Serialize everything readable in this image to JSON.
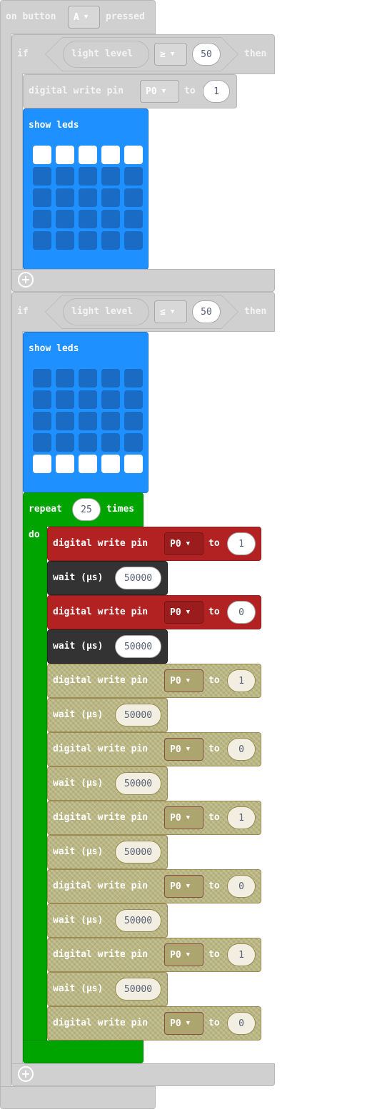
{
  "event": {
    "prefix": "on button",
    "button": "A",
    "suffix": "pressed"
  },
  "if1": {
    "if_label": "if",
    "sensor": "light level",
    "operator": "≥",
    "value": "50",
    "then_label": "then",
    "digital_write": {
      "label": "digital write pin",
      "pin": "P0",
      "to": "to",
      "value": "1"
    },
    "show_leds": {
      "label": "show leds",
      "grid": [
        [
          1,
          1,
          1,
          1,
          1
        ],
        [
          0,
          0,
          0,
          0,
          0
        ],
        [
          0,
          0,
          0,
          0,
          0
        ],
        [
          0,
          0,
          0,
          0,
          0
        ],
        [
          0,
          0,
          0,
          0,
          0
        ]
      ]
    }
  },
  "if2": {
    "if_label": "if",
    "sensor": "light level",
    "operator": "≤",
    "value": "50",
    "then_label": "then",
    "show_leds": {
      "label": "show leds",
      "grid": [
        [
          0,
          0,
          0,
          0,
          0
        ],
        [
          0,
          0,
          0,
          0,
          0
        ],
        [
          0,
          0,
          0,
          0,
          0
        ],
        [
          0,
          0,
          0,
          0,
          0
        ],
        [
          1,
          1,
          1,
          1,
          1
        ]
      ]
    },
    "repeat": {
      "label": "repeat",
      "times_value": "25",
      "times_label": "times",
      "do_label": "do",
      "body": [
        {
          "kind": "write",
          "style": "active",
          "label": "digital write pin",
          "pin": "P0",
          "to": "to",
          "value": "1"
        },
        {
          "kind": "wait",
          "style": "active",
          "label": "wait (µs)",
          "value": "50000"
        },
        {
          "kind": "write",
          "style": "active",
          "label": "digital write pin",
          "pin": "P0",
          "to": "to",
          "value": "0"
        },
        {
          "kind": "wait",
          "style": "active",
          "label": "wait (µs)",
          "value": "50000"
        },
        {
          "kind": "write",
          "style": "disabled",
          "label": "digital write pin",
          "pin": "P0",
          "to": "to",
          "value": "1"
        },
        {
          "kind": "wait",
          "style": "disabled",
          "label": "wait (µs)",
          "value": "50000"
        },
        {
          "kind": "write",
          "style": "disabled",
          "label": "digital write pin",
          "pin": "P0",
          "to": "to",
          "value": "0"
        },
        {
          "kind": "wait",
          "style": "disabled",
          "label": "wait (µs)",
          "value": "50000"
        },
        {
          "kind": "write",
          "style": "disabled",
          "label": "digital write pin",
          "pin": "P0",
          "to": "to",
          "value": "1"
        },
        {
          "kind": "wait",
          "style": "disabled",
          "label": "wait (µs)",
          "value": "50000"
        },
        {
          "kind": "write",
          "style": "disabled",
          "label": "digital write pin",
          "pin": "P0",
          "to": "to",
          "value": "0"
        },
        {
          "kind": "wait",
          "style": "disabled",
          "label": "wait (µs)",
          "value": "50000"
        },
        {
          "kind": "write",
          "style": "disabled",
          "label": "digital write pin",
          "pin": "P0",
          "to": "to",
          "value": "1"
        },
        {
          "kind": "wait",
          "style": "disabled",
          "label": "wait (µs)",
          "value": "50000"
        },
        {
          "kind": "write",
          "style": "disabled",
          "label": "digital write pin",
          "pin": "P0",
          "to": "to",
          "value": "0"
        }
      ]
    }
  },
  "colors": {
    "logic": "#d0d0d0",
    "basic": "#1e90ff",
    "loops": "#00a400",
    "pins": "#b22222",
    "control": "#333333",
    "disabled": "#b9b77c"
  }
}
